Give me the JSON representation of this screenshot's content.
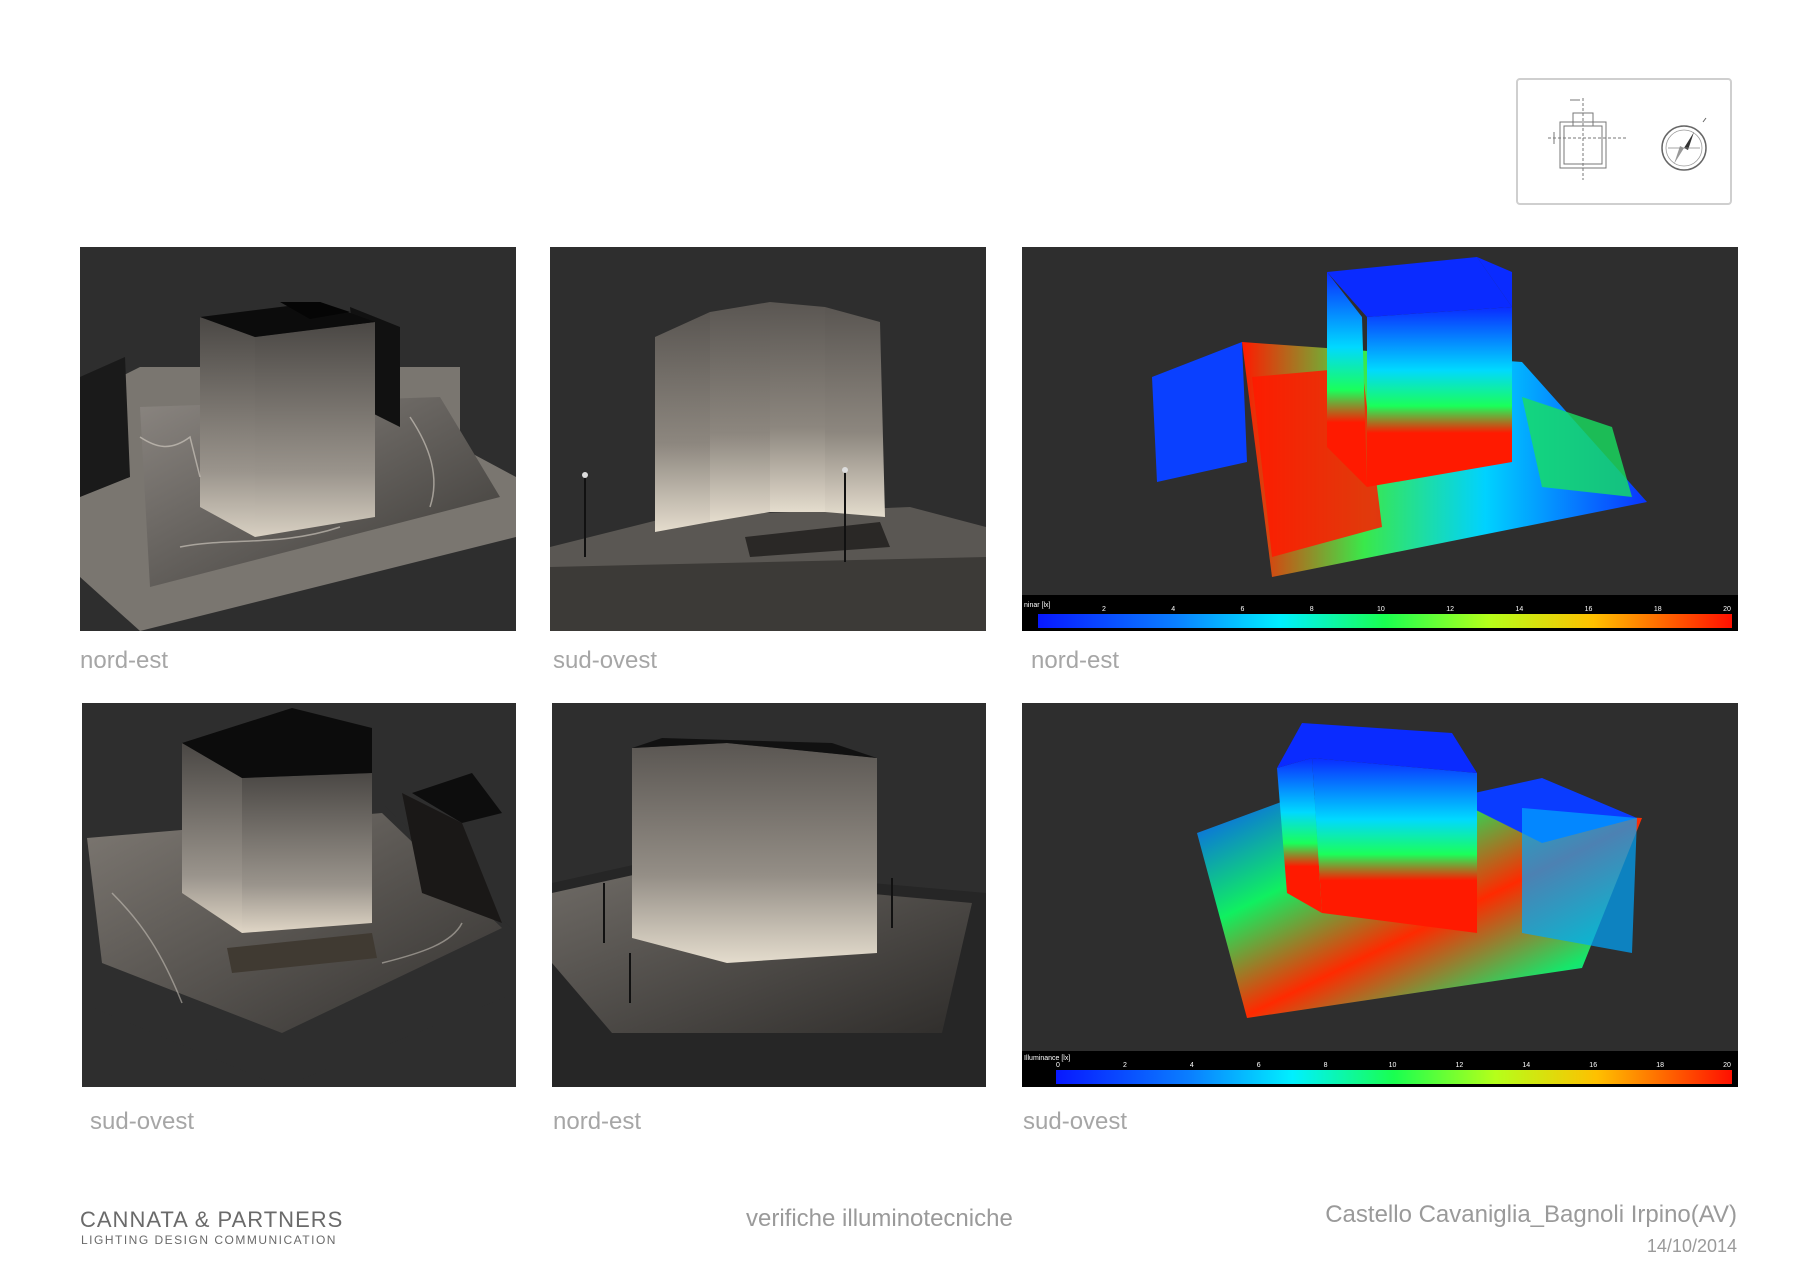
{
  "panels": [
    {
      "caption": "nord-est"
    },
    {
      "caption": "sud-ovest"
    },
    {
      "caption": "nord-est"
    },
    {
      "caption": "sud-ovest"
    },
    {
      "caption": "nord-est"
    },
    {
      "caption": "sud-ovest"
    }
  ],
  "legend_top": {
    "label": "ninar [lx]",
    "ticks": [
      "2",
      "4",
      "6",
      "8",
      "10",
      "12",
      "14",
      "16",
      "18",
      "20"
    ]
  },
  "legend_bottom": {
    "label": "Illuminance [lx]",
    "ticks": [
      "0",
      "2",
      "4",
      "6",
      "8",
      "10",
      "12",
      "14",
      "16",
      "18",
      "20"
    ]
  },
  "footer": {
    "company": "CANNATA & PARTNERS",
    "tagline": "LIGHTING DESIGN COMMUNICATION",
    "subject": "verifiche illuminotecniche",
    "project": "Castello Cavaniglia_Bagnoli Irpino(AV)",
    "date": "14/10/2014"
  },
  "colors": {
    "panel_bg": "#2e2e2e",
    "caption": "#a6a6a6",
    "false_color_low": "#0a2bff",
    "false_color_high": "#ff1a00"
  }
}
